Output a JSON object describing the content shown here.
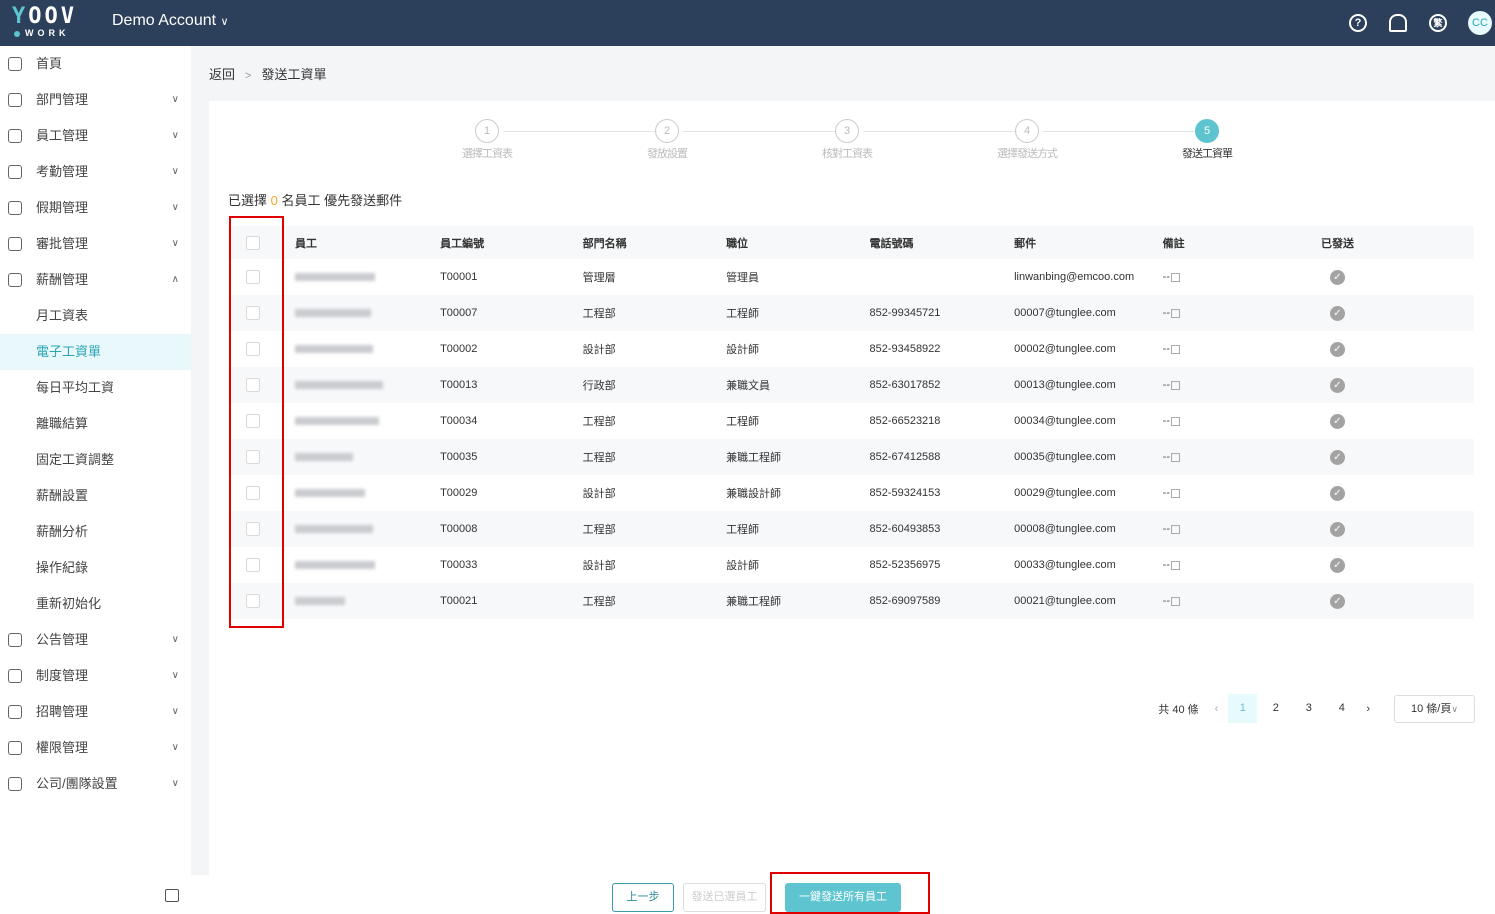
{
  "header": {
    "logo_text": "YOOV",
    "logo_sub": "WORK",
    "account": "Demo Account",
    "icons": [
      "help-icon",
      "bell-icon",
      "language-icon"
    ],
    "lang_glyph": "繁",
    "avatar": "CC"
  },
  "sidebar": {
    "items": [
      {
        "label": "首頁",
        "icon": "dashboard-icon",
        "chev": ""
      },
      {
        "label": "部門管理",
        "icon": "org-icon",
        "chev": "∨"
      },
      {
        "label": "員工管理",
        "icon": "users-icon",
        "chev": "∨"
      },
      {
        "label": "考勤管理",
        "icon": "calendar-icon",
        "chev": "∨"
      },
      {
        "label": "假期管理",
        "icon": "leave-icon",
        "chev": "∨"
      },
      {
        "label": "審批管理",
        "icon": "approval-icon",
        "chev": "∨"
      },
      {
        "label": "薪酬管理",
        "icon": "dollar-icon",
        "chev": "∧"
      }
    ],
    "sub": [
      "月工資表",
      "電子工資單",
      "每日平均工資",
      "離職結算",
      "固定工資調整",
      "薪酬設置",
      "薪酬分析",
      "操作紀錄",
      "重新初始化"
    ],
    "active_sub": "電子工資單",
    "bottom": [
      {
        "label": "公告管理",
        "icon": "megaphone-icon",
        "chev": "∨"
      },
      {
        "label": "制度管理",
        "icon": "book-icon",
        "chev": "∨"
      },
      {
        "label": "招聘管理",
        "icon": "briefcase-icon",
        "chev": "∨"
      },
      {
        "label": "權限管理",
        "icon": "shield-icon",
        "chev": "∨"
      },
      {
        "label": "公司/團隊設置",
        "icon": "building-icon",
        "chev": "∨"
      }
    ]
  },
  "breadcrumb": {
    "back": "返回",
    "sep": ">",
    "current": "發送工資單"
  },
  "steps": [
    {
      "n": "1",
      "label": "選擇工資表"
    },
    {
      "n": "2",
      "label": "發放設置"
    },
    {
      "n": "3",
      "label": "核對工資表"
    },
    {
      "n": "4",
      "label": "選擇發送方式"
    },
    {
      "n": "5",
      "label": "發送工資單"
    }
  ],
  "current_step": 5,
  "selection": {
    "prefix": "已選擇",
    "count": "0",
    "suffix": "名員工 優先發送郵件"
  },
  "table": {
    "columns": [
      "員工",
      "員工編號",
      "部門名稱",
      "職位",
      "電話號碼",
      "郵件",
      "備註",
      "已發送"
    ],
    "rows": [
      {
        "id": "T00001",
        "dept": "管理層",
        "pos": "管理員",
        "phone": "",
        "email": "linwanbing@emcoo.com",
        "remark": "--",
        "sent": true
      },
      {
        "id": "T00007",
        "dept": "工程部",
        "pos": "工程師",
        "phone": "852-99345721",
        "email": "00007@tunglee.com",
        "remark": "--",
        "sent": true
      },
      {
        "id": "T00002",
        "dept": "設計部",
        "pos": "設計師",
        "phone": "852-93458922",
        "email": "00002@tunglee.com",
        "remark": "--",
        "sent": true
      },
      {
        "id": "T00013",
        "dept": "行政部",
        "pos": "兼職文員",
        "phone": "852-63017852",
        "email": "00013@tunglee.com",
        "remark": "--",
        "sent": true
      },
      {
        "id": "T00034",
        "dept": "工程部",
        "pos": "工程師",
        "phone": "852-66523218",
        "email": "00034@tunglee.com",
        "remark": "--",
        "sent": true
      },
      {
        "id": "T00035",
        "dept": "工程部",
        "pos": "兼職工程師",
        "phone": "852-67412588",
        "email": "00035@tunglee.com",
        "remark": "--",
        "sent": true
      },
      {
        "id": "T00029",
        "dept": "設計部",
        "pos": "兼職設計師",
        "phone": "852-59324153",
        "email": "00029@tunglee.com",
        "remark": "--",
        "sent": true
      },
      {
        "id": "T00008",
        "dept": "工程部",
        "pos": "工程師",
        "phone": "852-60493853",
        "email": "00008@tunglee.com",
        "remark": "--",
        "sent": true
      },
      {
        "id": "T00033",
        "dept": "設計部",
        "pos": "設計師",
        "phone": "852-52356975",
        "email": "00033@tunglee.com",
        "remark": "--",
        "sent": true
      },
      {
        "id": "T00021",
        "dept": "工程部",
        "pos": "兼職工程師",
        "phone": "852-69097589",
        "email": "00021@tunglee.com",
        "remark": "--",
        "sent": true
      }
    ]
  },
  "pagination": {
    "total": "共 40 條",
    "pages": [
      "1",
      "2",
      "3",
      "4"
    ],
    "current": "1",
    "prev": "‹",
    "next": "›",
    "page_size": "10 條/頁"
  },
  "footer": {
    "prev": "上一步",
    "send_selected": "發送已選員工",
    "send_all": "一鍵發送所有員工"
  },
  "colors": {
    "topbar": "#2c3f5b",
    "accent": "#5ec4cf",
    "highlight": "#e00000"
  }
}
